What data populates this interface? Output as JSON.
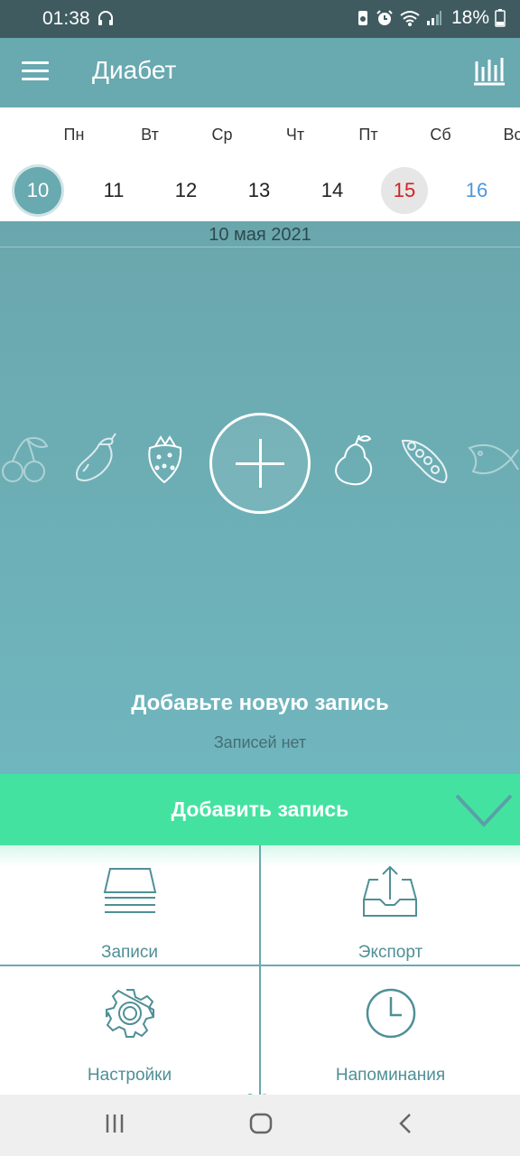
{
  "status_bar": {
    "time": "01:38",
    "battery_percent": "18%",
    "icons": [
      "headphones-icon",
      "battery-saver-icon",
      "alarm-icon",
      "wifi-icon",
      "signal-icon",
      "battery-icon"
    ]
  },
  "app_bar": {
    "title": "Диабет",
    "menu_icon": "hamburger-menu-icon",
    "stats_icon": "bar-chart-icon"
  },
  "week": {
    "days": [
      {
        "name": "Пн",
        "date": "10",
        "state": "selected"
      },
      {
        "name": "Вт",
        "date": "11",
        "state": "normal"
      },
      {
        "name": "Ср",
        "date": "12",
        "state": "normal"
      },
      {
        "name": "Чт",
        "date": "13",
        "state": "normal"
      },
      {
        "name": "Пт",
        "date": "14",
        "state": "normal"
      },
      {
        "name": "Сб",
        "date": "15",
        "state": "saturday"
      },
      {
        "name": "Вс",
        "date": "16",
        "state": "sunday"
      }
    ]
  },
  "main": {
    "date_label": "10 мая 2021",
    "empty_title": "Добавьте новую запись",
    "empty_subtitle": "Записей нет",
    "food_icons": [
      "cherry-icon",
      "eggplant-icon",
      "strawberry-icon",
      "pear-icon",
      "pea-pod-icon",
      "fish-icon"
    ]
  },
  "add_bar": {
    "label": "Добавить запись"
  },
  "tiles": {
    "records": "Записи",
    "export": "Экспорт",
    "settings": "Настройки",
    "reminders": "Напоминания"
  },
  "colors": {
    "primary": "#69a9b0",
    "accent_green": "#44e2a0",
    "saturday_red": "#d32222",
    "sunday_blue": "#4f97d9",
    "status_bar": "#3f5b60"
  }
}
